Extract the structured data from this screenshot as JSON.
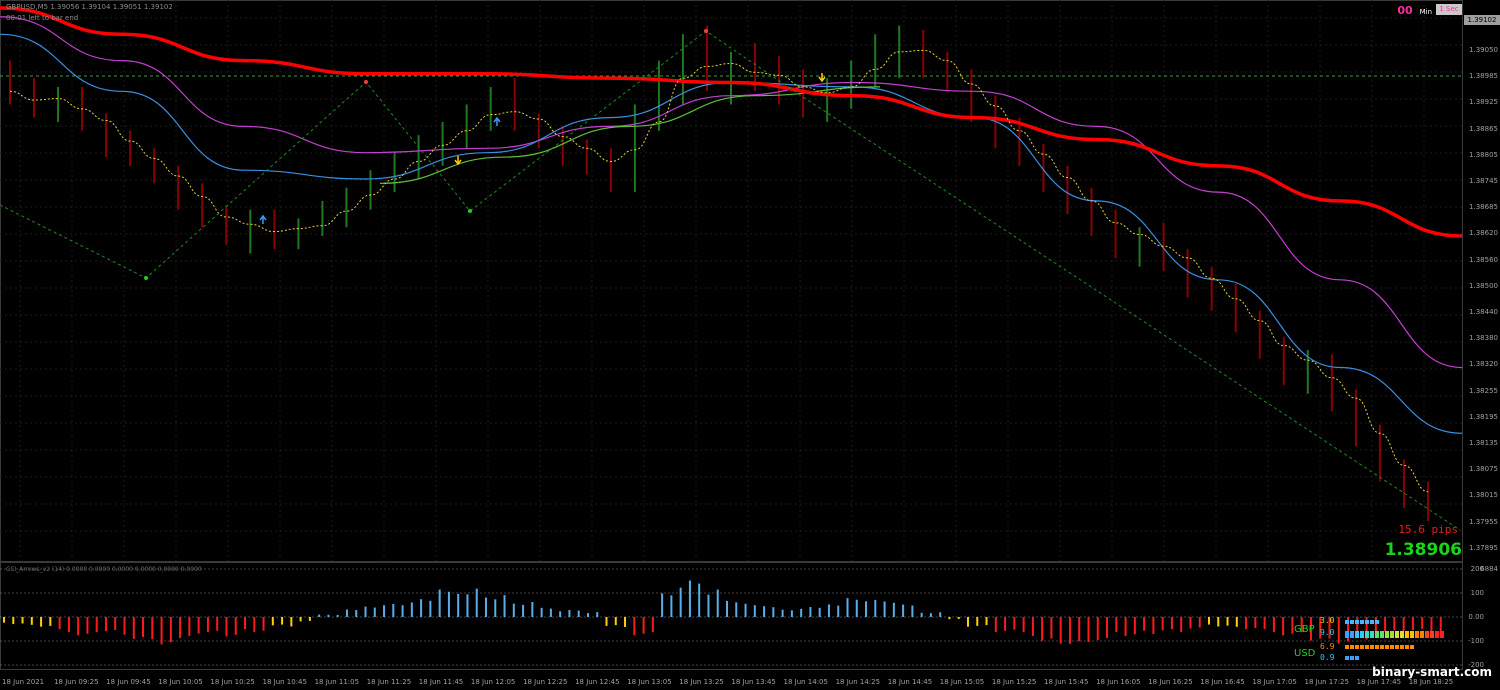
{
  "header": {
    "symbol_info": "GBPUSD,M5  1.39056 1.39104 1.39051 1.39102",
    "bar_timer": "00:01 left to bar end",
    "timer_value": "00",
    "timer_min": "Min",
    "timer_sec": "1 Sec"
  },
  "price_axis": {
    "labels": [
      "1.39050",
      "1.38985",
      "1.38925",
      "1.38865",
      "1.38805",
      "1.38745",
      "1.38685",
      "1.38620",
      "1.38560",
      "1.38500",
      "1.38440",
      "1.38380",
      "1.38320",
      "1.38255",
      "1.38195",
      "1.38135",
      "1.38075",
      "1.38015",
      "1.37955",
      "1.37895"
    ],
    "current_price_tag": "1.39102",
    "range": [
      1.3787,
      1.3912
    ]
  },
  "pips_label": "15.6 pips",
  "big_price": "1.38906",
  "indicator": {
    "header": "CCI_Arrows_v2 (14) 0.0000 0.0000 0.0000 0.0000 0.0000 0.0000",
    "axis_labels": [
      "200",
      "100",
      "0.00",
      "-100",
      "-200"
    ],
    "upper_label": "6884",
    "range": [
      -220,
      220
    ]
  },
  "strength_panel": {
    "gbp_label": "GBP",
    "usd_label": "USD",
    "gbp_values": [
      "3.0",
      "9.0"
    ],
    "usd_values": [
      "6.9",
      "0.9"
    ]
  },
  "time_axis": [
    "18 Jun 2021",
    "18 Jun 09:25",
    "18 Jun 09:45",
    "18 Jun 10:05",
    "18 Jun 10:25",
    "18 Jun 10:45",
    "18 Jun 11:05",
    "18 Jun 11:25",
    "18 Jun 11:45",
    "18 Jun 12:05",
    "18 Jun 12:25",
    "18 Jun 12:45",
    "18 Jun 13:05",
    "18 Jun 13:25",
    "18 Jun 13:45",
    "18 Jun 14:05",
    "18 Jun 14:25",
    "18 Jun 14:45",
    "18 Jun 15:05",
    "18 Jun 15:25",
    "18 Jun 15:45",
    "18 Jun 16:05",
    "18 Jun 16:25",
    "18 Jun 16:45",
    "18 Jun 17:05",
    "18 Jun 17:25",
    "18 Jun 17:45",
    "18 Jun 18:25"
  ],
  "watermark": "binary-smart.com",
  "colors": {
    "bull": "#1f7a1f",
    "bear": "#8b0000",
    "ma_red": "#ff0000",
    "ma_magenta": "#c53fd1",
    "ma_blue": "#3a8fe0",
    "ma_green": "#5fbf3a",
    "ma_yellow_dotted": "#e8d23a",
    "zigzag": "#1e8c1e",
    "hist_blue": "#5aaee8",
    "hist_red": "#ff1a1a",
    "hist_yellow": "#ffd000",
    "grid": "#1c1c1c",
    "level_dashed": "#3aa33a"
  },
  "chart_data": {
    "type": "candlestick",
    "title": "GBPUSD,M5",
    "ohlc_bars": [
      [
        1.3898,
        1.39,
        1.389,
        1.3893
      ],
      [
        1.3893,
        1.3896,
        1.3887,
        1.3889
      ],
      [
        1.3889,
        1.3894,
        1.3886,
        1.3892
      ],
      [
        1.3892,
        1.3894,
        1.3884,
        1.3886
      ],
      [
        1.3886,
        1.3888,
        1.3878,
        1.3881
      ],
      [
        1.3881,
        1.3884,
        1.3876,
        1.3878
      ],
      [
        1.3878,
        1.388,
        1.3872,
        1.3874
      ],
      [
        1.3874,
        1.3876,
        1.3866,
        1.3869
      ],
      [
        1.3869,
        1.3872,
        1.3862,
        1.3864
      ],
      [
        1.3864,
        1.3867,
        1.3858,
        1.386
      ],
      [
        1.386,
        1.3866,
        1.3856,
        1.3864
      ],
      [
        1.3864,
        1.3866,
        1.3857,
        1.3859
      ],
      [
        1.3859,
        1.3864,
        1.3857,
        1.3862
      ],
      [
        1.3862,
        1.3868,
        1.386,
        1.3866
      ],
      [
        1.3866,
        1.3871,
        1.3862,
        1.3869
      ],
      [
        1.3869,
        1.3875,
        1.3866,
        1.3873
      ],
      [
        1.3873,
        1.3879,
        1.387,
        1.3877
      ],
      [
        1.3877,
        1.3883,
        1.3873,
        1.3881
      ],
      [
        1.3881,
        1.3886,
        1.3876,
        1.3884
      ],
      [
        1.3884,
        1.389,
        1.388,
        1.3887
      ],
      [
        1.3887,
        1.3894,
        1.3884,
        1.3892
      ],
      [
        1.3892,
        1.3896,
        1.3884,
        1.3886
      ],
      [
        1.3886,
        1.3888,
        1.388,
        1.3882
      ],
      [
        1.3882,
        1.3885,
        1.3876,
        1.388
      ],
      [
        1.388,
        1.3882,
        1.3874,
        1.3878
      ],
      [
        1.3878,
        1.388,
        1.387,
        1.3873
      ],
      [
        1.3873,
        1.389,
        1.387,
        1.3888
      ],
      [
        1.3888,
        1.39,
        1.3884,
        1.3897
      ],
      [
        1.3897,
        1.3906,
        1.389,
        1.3903
      ],
      [
        1.3903,
        1.3908,
        1.3893,
        1.3896
      ],
      [
        1.3896,
        1.3902,
        1.389,
        1.3899
      ],
      [
        1.3899,
        1.3904,
        1.3893,
        1.3897
      ],
      [
        1.3897,
        1.3901,
        1.389,
        1.3894
      ],
      [
        1.3894,
        1.3898,
        1.3887,
        1.3891
      ],
      [
        1.3891,
        1.3896,
        1.3886,
        1.3893
      ],
      [
        1.3893,
        1.39,
        1.3889,
        1.3898
      ],
      [
        1.3898,
        1.3906,
        1.3894,
        1.3903
      ],
      [
        1.3903,
        1.3908,
        1.3896,
        1.3905
      ],
      [
        1.3905,
        1.3907,
        1.3896,
        1.3899
      ],
      [
        1.3899,
        1.3902,
        1.3893,
        1.3896
      ],
      [
        1.3896,
        1.3898,
        1.3886,
        1.3889
      ],
      [
        1.3889,
        1.3892,
        1.388,
        1.3884
      ],
      [
        1.3884,
        1.3887,
        1.3876,
        1.3879
      ],
      [
        1.3879,
        1.3881,
        1.387,
        1.3873
      ],
      [
        1.3873,
        1.3876,
        1.3865,
        1.3868
      ],
      [
        1.3868,
        1.3871,
        1.386,
        1.3863
      ],
      [
        1.3863,
        1.3866,
        1.3855,
        1.3858
      ],
      [
        1.3858,
        1.3862,
        1.3853,
        1.386
      ],
      [
        1.386,
        1.3863,
        1.3852,
        1.3855
      ],
      [
        1.3855,
        1.3857,
        1.3846,
        1.385
      ],
      [
        1.385,
        1.3853,
        1.3843,
        1.3846
      ],
      [
        1.3846,
        1.3849,
        1.3838,
        1.3841
      ],
      [
        1.3841,
        1.3843,
        1.3832,
        1.3835
      ],
      [
        1.3835,
        1.3837,
        1.3826,
        1.3829
      ],
      [
        1.3829,
        1.3834,
        1.3824,
        1.3831
      ],
      [
        1.3831,
        1.3833,
        1.382,
        1.3823
      ],
      [
        1.3823,
        1.3825,
        1.3812,
        1.3815
      ],
      [
        1.3815,
        1.3817,
        1.3804,
        1.3807
      ],
      [
        1.3807,
        1.3809,
        1.3798,
        1.3801
      ],
      [
        1.3801,
        1.3804,
        1.3795,
        1.3797
      ]
    ],
    "ma_red": [
      1.3912,
      1.3906,
      1.39,
      1.3897,
      1.3897,
      1.3896,
      1.3895,
      1.3892,
      1.3887,
      1.3882,
      1.3876,
      1.3868,
      1.386
    ],
    "ma_magenta": [
      1.391,
      1.39,
      1.3885,
      1.3879,
      1.388,
      1.3885,
      1.3892,
      1.3895,
      1.3893,
      1.3885,
      1.387,
      1.385,
      1.383
    ],
    "ma_blue": [
      1.3906,
      1.3893,
      1.3875,
      1.3873,
      1.3879,
      1.3887,
      1.3895,
      1.3894,
      1.3887,
      1.3868,
      1.385,
      1.383,
      1.3815
    ],
    "ma_green": [
      1.3872,
      1.3878,
      1.3885,
      1.3892,
      1.3894
    ],
    "x_ticks": [
      "18 Jun 09:25",
      "18 Jun 11:05",
      "18 Jun 12:45",
      "18 Jun 14:25",
      "18 Jun 16:05",
      "18 Jun 17:45"
    ],
    "cci_histogram": [
      -30,
      -40,
      -60,
      -80,
      -60,
      -90,
      -110,
      -100,
      -70,
      -80,
      -60,
      -40,
      -20,
      10,
      30,
      50,
      60,
      80,
      110,
      120,
      90,
      60,
      40,
      30,
      20,
      -40,
      -80,
      100,
      150,
      110,
      70,
      50,
      30,
      40,
      60,
      80,
      70,
      50,
      20,
      -10,
      -40,
      -60,
      -80,
      -110,
      -120,
      -100,
      -80,
      -70,
      -60,
      -50,
      -40,
      -50,
      -60,
      -80,
      -100,
      -110,
      -90,
      -70,
      -60,
      -80
    ],
    "ylabel": "",
    "xlabel": ""
  }
}
